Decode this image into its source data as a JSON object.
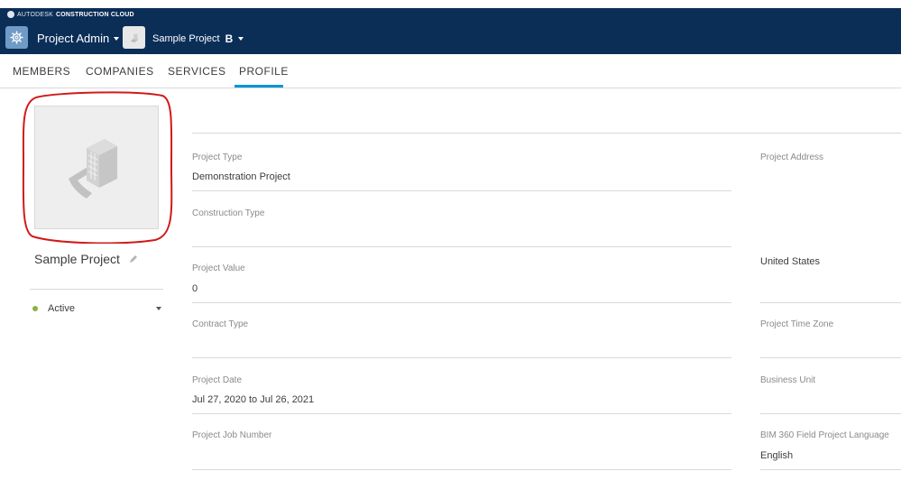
{
  "header": {
    "brand_prefix": "AUTODESK",
    "brand_name": "CONSTRUCTION CLOUD",
    "app_icon": "gear-icon",
    "app_name": "Project Admin",
    "project_name": "Sample Project",
    "project_badge": "B",
    "colors": {
      "bar": "#0b2e57",
      "app_icon_bg": "#6f9bc6"
    }
  },
  "tabs": [
    {
      "label": "MEMBERS"
    },
    {
      "label": "COMPANIES"
    },
    {
      "label": "SERVICES"
    },
    {
      "label": "PROFILE",
      "active": true
    }
  ],
  "profile": {
    "project_name": "Sample Project",
    "status": "Active",
    "status_color": "#87b340",
    "highlight_color": "#d11a1a",
    "accent_color": "#0696d7"
  },
  "fields": {
    "project_type": {
      "label": "Project Type",
      "value": "Demonstration Project"
    },
    "construction_type": {
      "label": "Construction Type",
      "value": ""
    },
    "project_value": {
      "label": "Project Value",
      "value": "0"
    },
    "contract_type": {
      "label": "Contract Type",
      "value": ""
    },
    "project_date": {
      "label": "Project Date",
      "value": "Jul 27, 2020 to Jul 26, 2021"
    },
    "project_job_number": {
      "label": "Project Job Number",
      "value": ""
    },
    "project_address": {
      "label": "Project Address",
      "value": ""
    },
    "country": {
      "value": "United States"
    },
    "project_time_zone": {
      "label": "Project Time Zone",
      "value": ""
    },
    "business_unit": {
      "label": "Business Unit",
      "value": ""
    },
    "field_language": {
      "label": "BIM 360 Field Project Language",
      "value": "English"
    }
  }
}
